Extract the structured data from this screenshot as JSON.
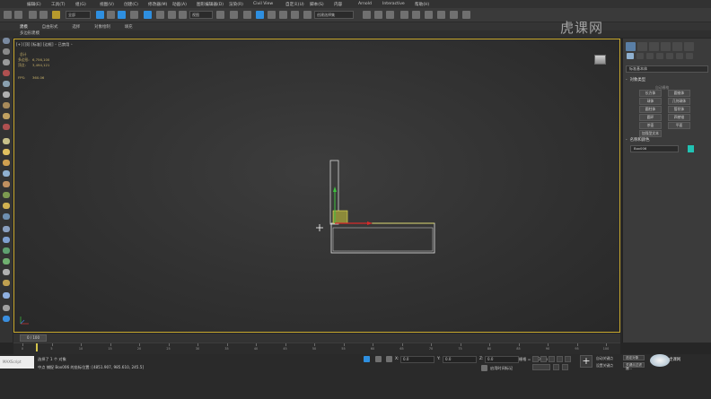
{
  "menu": {
    "items": [
      "编辑(E)",
      "工具(T)",
      "组(G)",
      "视图(V)",
      "创建(C)",
      "修改器(M)",
      "动画(A)",
      "图形编辑器(D)",
      "渲染(R)",
      "Civil View",
      "自定义(U)",
      "脚本(S)",
      "内容",
      "Arnold",
      "Interactive",
      "帮助(H)"
    ]
  },
  "toolbar": {
    "undo_icon": "undo-icon",
    "selection_filter": "全部",
    "view_dropdown": "视图",
    "named_set": "创建选择集"
  },
  "ribbon": {
    "tabs": [
      "建模",
      "自由形式",
      "选择",
      "对象绘制",
      "填充"
    ],
    "sub_label": "多边形建模"
  },
  "viewport": {
    "label": "[+] [顶] [标准] [边框] ◦ 已禁用 ◦",
    "stats_title": "总计",
    "polys_label": "多边形:",
    "polys_value": "6,756,100",
    "verts_label": "顶点:",
    "verts_value": "3,494,121",
    "fps_label": "FPS:",
    "fps_value": "360.06",
    "accent_color": "#c9a92e"
  },
  "right_panel": {
    "dropdown": "标准基本体",
    "section_object_type": "对象类型",
    "autogrid": "自动栅格",
    "buttons": [
      "长方体",
      "圆锥体",
      "球体",
      "几何球体",
      "圆柱体",
      "管状体",
      "圆环",
      "四棱锥",
      "茶壶",
      "平面",
      "加强型文本"
    ],
    "section_name_color": "名称和颜色",
    "name_value": "Box006",
    "color": "#21c2b3"
  },
  "timeline": {
    "frame": "0 / 100",
    "ticks": [
      "0",
      "5",
      "10",
      "15",
      "20",
      "25",
      "30",
      "35",
      "40",
      "45",
      "50",
      "55",
      "60",
      "65",
      "70",
      "75",
      "80",
      "85",
      "90",
      "95",
      "100"
    ]
  },
  "status": {
    "maxscript": "MAXScript",
    "selection": "选择了 1 个 对象",
    "coords_msg": "中点 捕捉 Box006 的坐标位置: [4851.907, 985.610, 245.5]",
    "x_label": "X:",
    "x_value": "0.0",
    "y_label": "Y:",
    "y_value": "0.0",
    "z_label": "Z:",
    "z_value": "0.0",
    "grid": "栅格 = 10.0mm",
    "add_time_tag": "启用时间标记",
    "auto_key": "自动关键点",
    "set_key": "设置关键点",
    "selected": "选定对象",
    "key_filter": "关键点过滤器..."
  },
  "watermark": {
    "text": "虎课网",
    "logo_text": "虎课网"
  }
}
